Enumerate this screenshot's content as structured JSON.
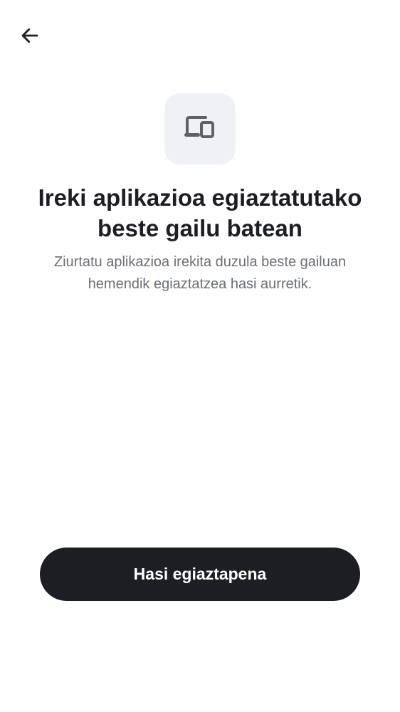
{
  "nav": {
    "back_icon": "arrow-left-icon"
  },
  "header": {
    "icon": "devices-icon",
    "title": "Ireki aplikazioa egiaztatutako beste gailu batean",
    "subtitle": "Ziurtatu aplikazioa irekita duzula beste gailuan hemendik egiaztatzea hasi aurretik."
  },
  "actions": {
    "start_label": "Hasi egiaztapena"
  },
  "colors": {
    "text_primary": "#1d1e24",
    "text_secondary": "#6d6f78",
    "icon_tile_bg": "#f0f1f5",
    "icon_color": "#5f6068",
    "button_bg": "#1d1e24",
    "button_text": "#ffffff"
  }
}
